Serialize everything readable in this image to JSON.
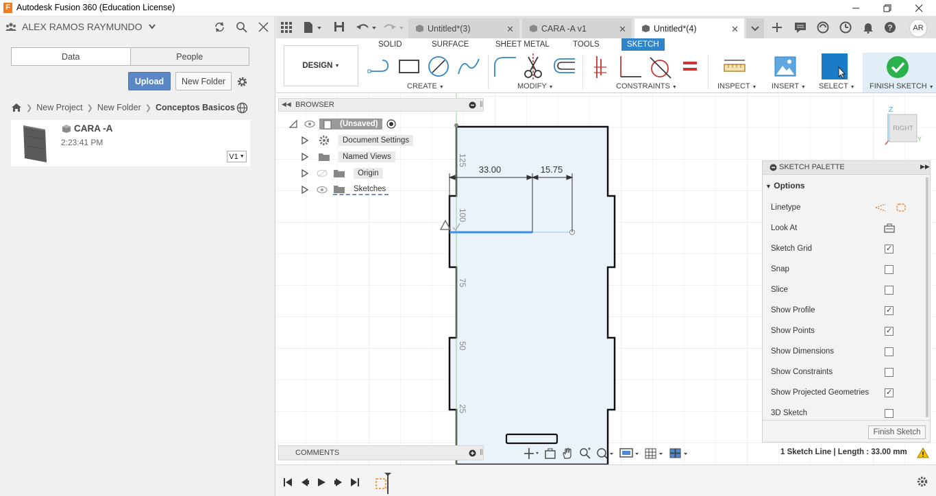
{
  "window": {
    "title": "Autodesk Fusion 360 (Education License)"
  },
  "data_panel": {
    "user_name": "ALEX RAMOS RAYMUNDO",
    "tabs": [
      "Data",
      "People"
    ],
    "upload_label": "Upload",
    "new_folder_label": "New Folder",
    "breadcrumb": [
      "New Project",
      "New Folder",
      "Conceptos Basicos"
    ],
    "file": {
      "name": "CARA -A",
      "time": "2:23:41 PM",
      "version": "V1"
    }
  },
  "doc_tabs": [
    {
      "label": "Untitled*(3)",
      "active": false
    },
    {
      "label": "CARA -A v1",
      "active": false
    },
    {
      "label": "Untitled*(4)",
      "active": true
    }
  ],
  "user_initials": "AR",
  "ribbon": {
    "workspace": "DESIGN",
    "tabs": [
      "SOLID",
      "SURFACE",
      "SHEET METAL",
      "TOOLS",
      "SKETCH"
    ],
    "active_tab": "SKETCH",
    "groups": {
      "create": "CREATE",
      "modify": "MODIFY",
      "constraints": "CONSTRAINTS",
      "inspect": "INSPECT",
      "insert": "INSERT",
      "select": "SELECT",
      "finish": "FINISH SKETCH"
    }
  },
  "browser": {
    "title": "BROWSER",
    "root": "(Unsaved)",
    "items": [
      "Document Settings",
      "Named Views",
      "Origin",
      "Sketches"
    ]
  },
  "sketch": {
    "dimensions": [
      "33.00",
      "15.75"
    ],
    "ruler": [
      "125",
      "100",
      "75",
      "50",
      "25"
    ]
  },
  "viewcube_label": "RIGHT",
  "palette": {
    "title": "SKETCH PALETTE",
    "section": "Options",
    "rows": [
      {
        "label": "Linetype",
        "kind": "icons"
      },
      {
        "label": "Look At",
        "kind": "icon"
      },
      {
        "label": "Sketch Grid",
        "checked": true
      },
      {
        "label": "Snap",
        "checked": false
      },
      {
        "label": "Slice",
        "checked": false
      },
      {
        "label": "Show Profile",
        "checked": true
      },
      {
        "label": "Show Points",
        "checked": true
      },
      {
        "label": "Show Dimensions",
        "checked": false
      },
      {
        "label": "Show Constraints",
        "checked": false
      },
      {
        "label": "Show Projected Geometries",
        "checked": true
      },
      {
        "label": "3D Sketch",
        "checked": false
      }
    ],
    "finish_label": "Finish Sketch"
  },
  "comments_label": "COMMENTS",
  "status_message": "1 Sketch Line | Length : 33.00 mm",
  "colors": {
    "accent": "#2e86c8",
    "upload": "#5b87c6",
    "finish_check": "#2bb24c",
    "sketch_fill": "#eaf2fa",
    "selected_line": "#3b8ee5",
    "warning": "#f2c200"
  }
}
